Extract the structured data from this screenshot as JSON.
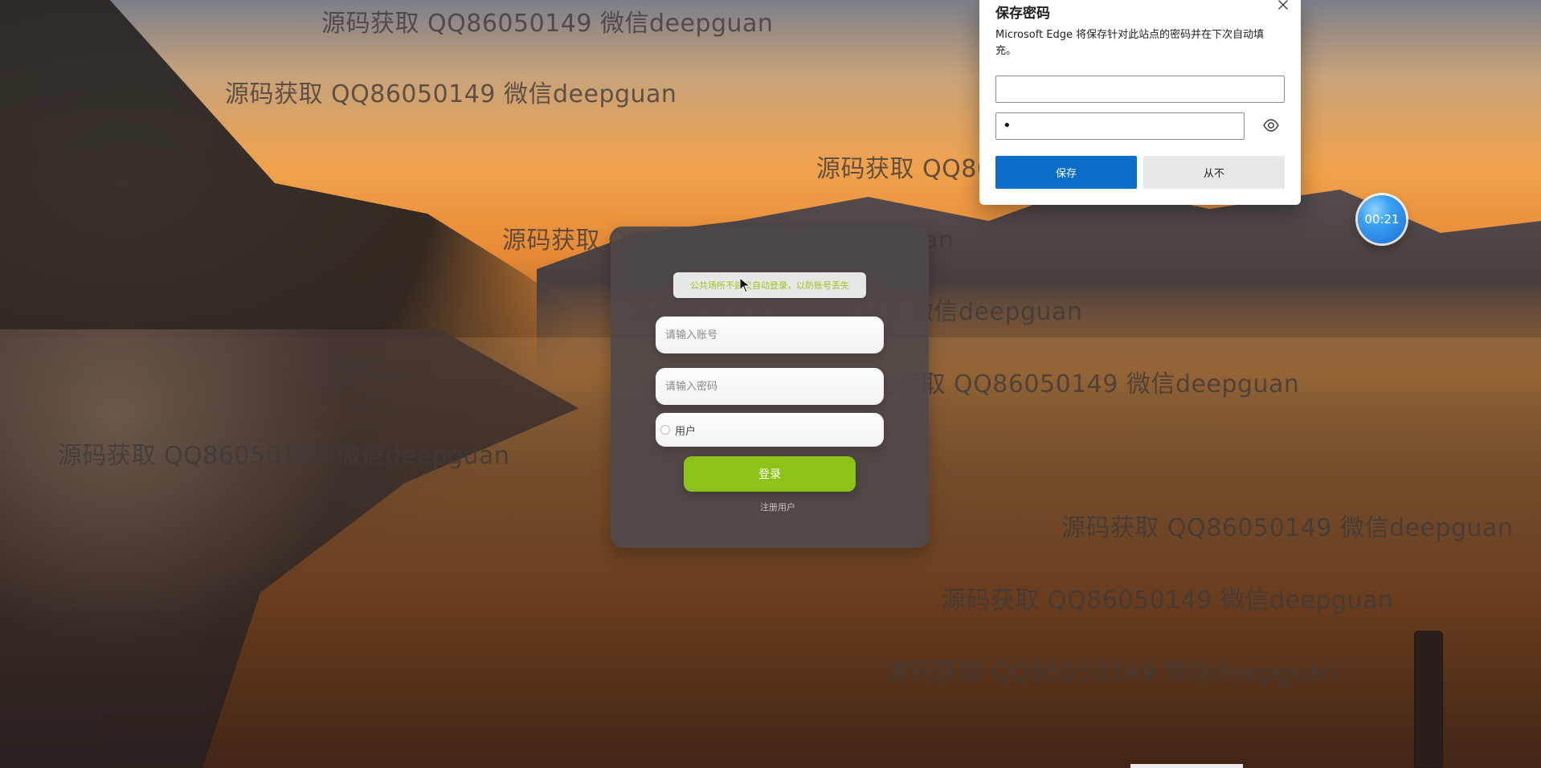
{
  "watermarks": [
    {
      "text": "源码获取 QQ86050149 微信deepguan"
    },
    {
      "text": "源码获取 QQ86050149 微信deepguan"
    },
    {
      "text": "源码获取 QQ86050149 微信deepguan"
    },
    {
      "text": "源码获取 QQ86050149 微信deepguan"
    },
    {
      "text": "源码获取 QQ86050149 微信deepguan"
    },
    {
      "text": "源码获取 QQ86050149 微信deepguan"
    },
    {
      "text": "源码获取 QQ86050149 微信deepguan"
    },
    {
      "text": "源码获取 QQ86050149 微信deepguan"
    },
    {
      "text": "源码获取 QQ86050149 微信deepguan"
    },
    {
      "text": "源码获取 QQ86050149 微信deepguan"
    }
  ],
  "login": {
    "notice": "公共场所不建议自动登录，以防账号丢失",
    "account_placeholder": "请输入账号",
    "password_placeholder": "请输入密码",
    "role_label": "用户",
    "login_button": "登录",
    "register_link": "注册用户"
  },
  "edge_popup": {
    "title": "保存密码",
    "description": "Microsoft Edge 将保存针对此站点的密码并在下次自动填充。",
    "username_value": "",
    "password_mask": "•",
    "save_button": "保存",
    "never_button": "从不"
  },
  "timer": {
    "text": "00:21"
  },
  "colors": {
    "login_button": "#8bc316",
    "notice_text": "#95c81a",
    "edge_save": "#0a6ec8",
    "timer_blue": "#1e6fd6"
  }
}
